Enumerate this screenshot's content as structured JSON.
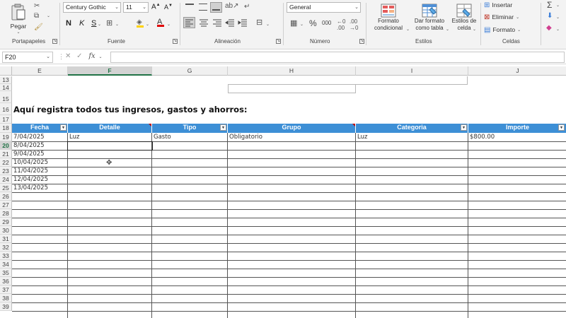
{
  "ribbon": {
    "groups": {
      "clipboard": "Portapapeles",
      "font": "Fuente",
      "alignment": "Alineación",
      "number": "Número",
      "styles": "Estilos",
      "cells": "Celdas"
    },
    "paste_label": "Pegar",
    "font_name": "Century Gothic",
    "font_size": "11",
    "number_format": "General",
    "bold": "N",
    "italic": "K",
    "underline": "S",
    "percent": "%",
    "thousands": "000",
    "conditional_format": [
      "Formato",
      "condicional"
    ],
    "format_table": [
      "Dar formato",
      "como tabla"
    ],
    "cell_styles": [
      "Estilos de",
      "celda"
    ],
    "insert": "Insertar",
    "delete": "Eliminar",
    "format": "Formato"
  },
  "formula_bar": {
    "name_box": "F20",
    "fx": "fx",
    "value": ""
  },
  "columns": [
    "E",
    "F",
    "G",
    "H",
    "I",
    "J"
  ],
  "selected_column": "F",
  "rows": [
    "13",
    "14",
    "15",
    "16",
    "17",
    "18",
    "19",
    "20",
    "21",
    "22",
    "23",
    "24",
    "25",
    "26",
    "27",
    "28",
    "29",
    "30",
    "31",
    "32",
    "33",
    "34",
    "35",
    "36",
    "37",
    "38",
    "39"
  ],
  "selected_row": "20",
  "sheet": {
    "title": "Aquí registra todos tus ingresos, gastos y ahorros:",
    "table_headers": [
      "Fecha",
      "Detalle",
      "Tipo",
      "Grupo",
      "Categoria",
      "Importe"
    ],
    "row19": [
      "7/04/2025",
      "Luz",
      "Gasto",
      "Obligatorio",
      "Luz",
      "$800.00"
    ],
    "dates": [
      "8/04/2025",
      "9/04/2025",
      "10/04/2025",
      "11/04/2025",
      "12/04/2025",
      "13/04/2025"
    ]
  },
  "colors": {
    "table_header": "#3d8fd6",
    "excel_green": "#217346"
  }
}
